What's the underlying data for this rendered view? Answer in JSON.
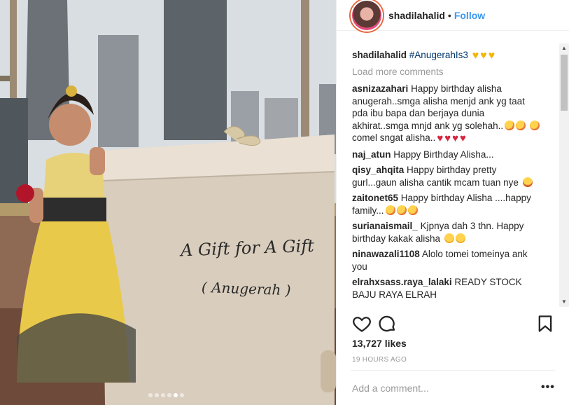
{
  "photo": {
    "box_title": "A Gift for A Gift",
    "box_subtitle": "( Anugerah )",
    "carousel_count": 6,
    "carousel_active": 5
  },
  "header": {
    "username": "shadilahalid",
    "separator": "•",
    "follow_label": "Follow"
  },
  "caption": {
    "user": "shadilahalid",
    "hashtag": "#AnugerahIs3",
    "emoji": "yellow-heart-emoji"
  },
  "load_more": "Load more comments",
  "comments": [
    {
      "user": "asnizazahari",
      "text": "Happy birthday alisha anugerah..smga alisha menjd ank yg taat pda ibu bapa dan berjaya dunia akhirat..smga mnjd ank yg solehah..",
      "text2": " comel sngat alisha.."
    },
    {
      "user": "naj_atun",
      "text": "Happy Birthday Alisha..."
    },
    {
      "user": "qisy_ahqita",
      "text": "Happy birthday pretty gurl...gaun alisha cantik mcam tuan nye "
    },
    {
      "user": "zaitonet65",
      "text": "Happy birthday Alisha ....happy family..."
    },
    {
      "user": "surianaismail_",
      "text": "Kjpnya dah 3 thn. Happy birthday kakak alisha "
    },
    {
      "user": "ninawazali1108",
      "text": "Alolo tomei tomeinya ank you"
    },
    {
      "user": "elrahxsass.raya_lalaki",
      "text": "READY STOCK BAJU RAYA ELRAH "
    }
  ],
  "actions": {
    "like_icon": "heart-icon",
    "comment_icon": "comment-icon",
    "save_icon": "bookmark-icon"
  },
  "likes": "13,727 likes",
  "timestamp": "19 HOURS AGO",
  "add_comment_placeholder": "Add a comment...",
  "more_label": "•••",
  "scroll_up": "▲",
  "scroll_down": "▼",
  "colors": {
    "link": "#3897f0",
    "hashtag": "#003569",
    "muted": "#999999"
  }
}
